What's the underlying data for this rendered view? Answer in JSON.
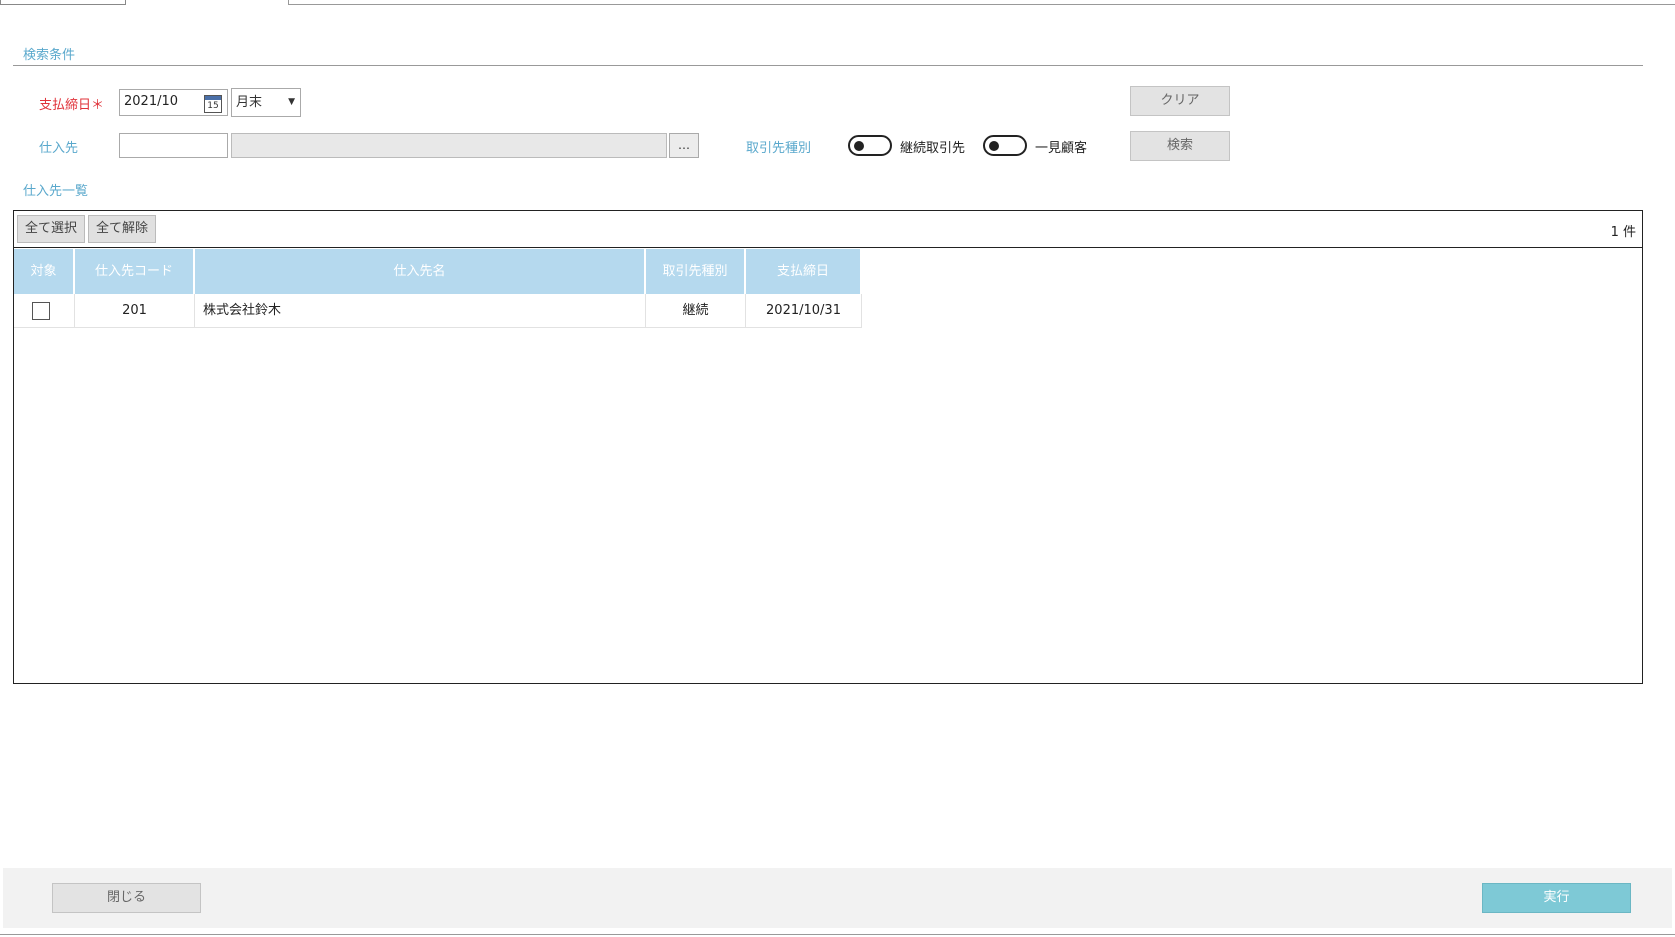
{
  "search_section": {
    "title": "検索条件",
    "closing_date_label": "支払締日＊",
    "closing_date_value": "2021/10",
    "calendar_icon_text": "15",
    "day_select_value": "月末",
    "supplier_label": "仕入先",
    "supplier_code_value": "",
    "supplier_name_value": "",
    "ellipsis_label": "…",
    "partner_type_label": "取引先種別",
    "toggle_continuous_label": "継続取引先",
    "toggle_onetime_label": "一見顧客",
    "clear_label": "クリア",
    "search_label": "検索"
  },
  "list_section": {
    "title": "仕入先一覧",
    "select_all_label": "全て選択",
    "deselect_all_label": "全て解除",
    "count_text": "1 件",
    "columns": [
      "対象",
      "仕入先コード",
      "仕入先名",
      "取引先種別",
      "支払締日"
    ],
    "rows": [
      {
        "code": "201",
        "name": "株式会社鈴木",
        "type": "継続",
        "date": "2021/10/31"
      }
    ]
  },
  "footer": {
    "close_label": "閉じる",
    "execute_label": "実行"
  }
}
